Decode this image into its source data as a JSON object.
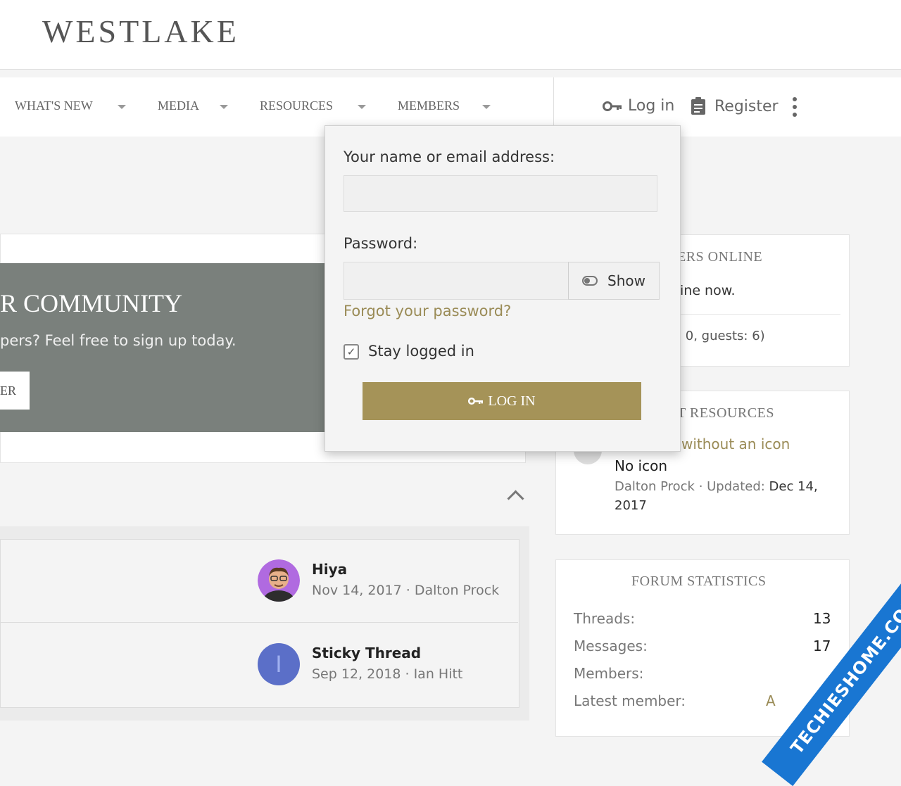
{
  "header": {
    "logo": "WESTLAKE"
  },
  "nav": {
    "items": [
      "WHAT'S NEW",
      "MEDIA",
      "RESOURCES",
      "MEMBERS"
    ],
    "login_label": "Log in",
    "register_label": "Register"
  },
  "banner": {
    "title": "R COMMUNITY",
    "subtitle": "pers? Feel free to sign up today.",
    "button_label": "ER"
  },
  "threads": [
    {
      "title": "Hiya",
      "meta": "Nov 14, 2017 · Dalton Prock"
    },
    {
      "title": "Sticky Thread",
      "meta": "Sep 12, 2018 · Ian Hitt",
      "avatar_letter": "I"
    }
  ],
  "sidebar": {
    "online": {
      "title": "ERS ONLINE",
      "text": "ine now.",
      "counts": ": 0, guests: 6)"
    },
    "resources": {
      "title": "T RESOURCES",
      "link": "without an icon",
      "item_title": "No icon",
      "item_meta_author": "Dalton Prock · Updated: ",
      "item_meta_date": "Dec 14,",
      "item_meta_year": "2017"
    },
    "stats": {
      "title": "FORUM STATISTICS",
      "rows": [
        {
          "label": "Threads:",
          "value": "13"
        },
        {
          "label": "Messages:",
          "value": "17"
        },
        {
          "label": "Members:",
          "value": ""
        },
        {
          "label": "Latest member:",
          "value": "A"
        }
      ]
    }
  },
  "login": {
    "name_label": "Your name or email address:",
    "name_value": "",
    "password_label": "Password:",
    "password_value": "",
    "show_label": "Show",
    "forgot_label": "Forgot your password?",
    "stay_label": "Stay logged in",
    "stay_checked": true,
    "button_label": "LOG IN"
  },
  "watermark": "TECHIESHOME.COM",
  "colors": {
    "accent": "#a59358",
    "link": "#9a8b56",
    "banner": "#7a807c"
  }
}
